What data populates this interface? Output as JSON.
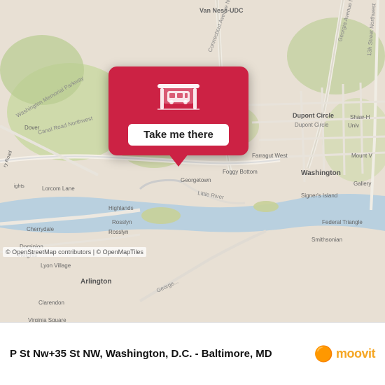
{
  "map": {
    "copyright": "© OpenStreetMap contributors | © OpenMapTiles"
  },
  "popup": {
    "button_label": "Take me there",
    "icon_alt": "bus-stop-icon"
  },
  "bottom_bar": {
    "location_title": "P St Nw+35 St NW, Washington, D.C. - Baltimore, MD",
    "moovit_logo": "moovit",
    "moovit_face": "🟠"
  }
}
